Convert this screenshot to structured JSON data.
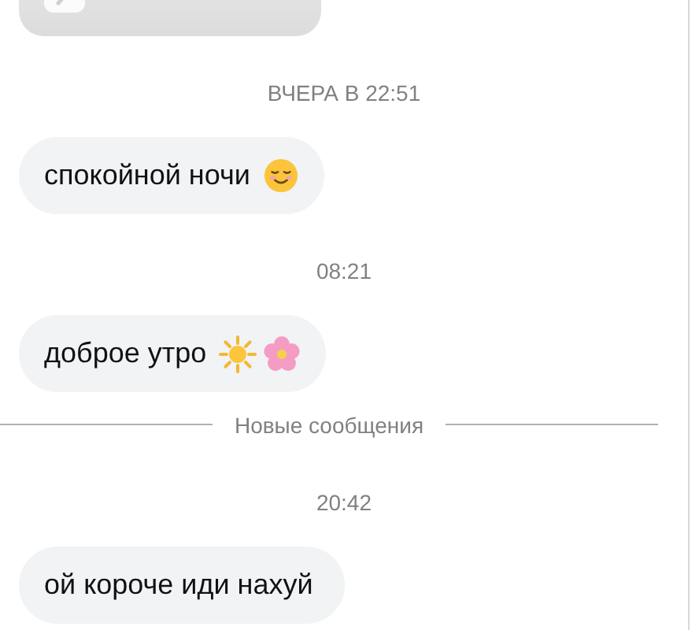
{
  "messages": [
    {
      "kind": "attachment"
    },
    {
      "kind": "timestamp",
      "text": "ВЧЕРА В 22:51"
    },
    {
      "kind": "message",
      "text": "спокойной ночи",
      "icons": [
        {
          "kind": "smile"
        }
      ]
    },
    {
      "kind": "timestamp",
      "text": "08:21"
    },
    {
      "kind": "message",
      "text": "доброе утро",
      "icons": [
        {
          "kind": "sun"
        },
        {
          "kind": "flower"
        }
      ]
    },
    {
      "kind": "divider",
      "text": "Новые сообщения"
    },
    {
      "kind": "timestamp",
      "text": "20:42"
    },
    {
      "kind": "message",
      "text": "ой короче иди нахуй"
    }
  ]
}
